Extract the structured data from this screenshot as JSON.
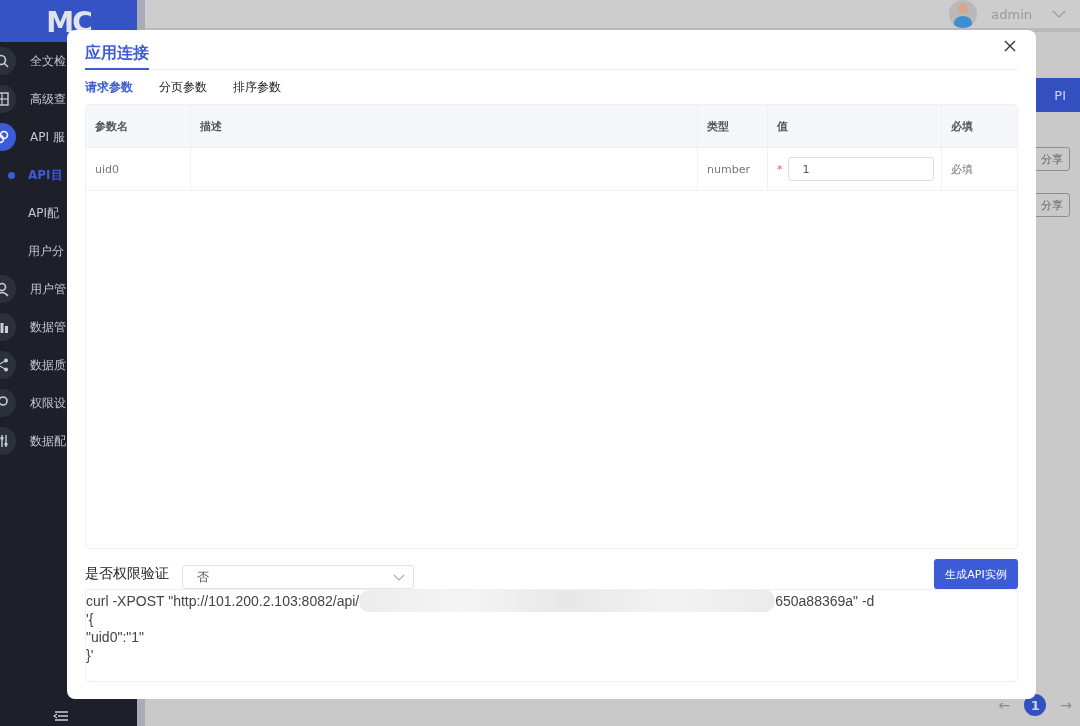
{
  "logo": "MC",
  "sidebar": {
    "items": [
      {
        "label": "全文检",
        "selected": false
      },
      {
        "label": "高级查",
        "selected": false
      },
      {
        "label": "API 服",
        "selected": true,
        "children": [
          {
            "label": "API目",
            "selected": true
          },
          {
            "label": "API配",
            "selected": false
          },
          {
            "label": "用户分",
            "selected": false
          }
        ]
      },
      {
        "label": "用户管",
        "selected": false
      },
      {
        "label": "数据管",
        "selected": false
      },
      {
        "label": "数据质",
        "selected": false
      },
      {
        "label": "权限设",
        "selected": false
      },
      {
        "label": "数据配",
        "selected": false
      }
    ]
  },
  "header": {
    "user": "admin"
  },
  "background": {
    "primary_button": "PI",
    "share_buttons": [
      "分享",
      "分享"
    ],
    "pagination": {
      "page": "1",
      "prev": "←",
      "next": "→"
    }
  },
  "dialog": {
    "title": "应用连接",
    "tabs": [
      {
        "label": "请求参数",
        "selected": true
      },
      {
        "label": "分页参数",
        "selected": false
      },
      {
        "label": "排序参数",
        "selected": false
      }
    ],
    "table": {
      "columns": [
        "参数名",
        "描述",
        "类型",
        "值",
        "必填"
      ],
      "rows": [
        {
          "name": "uid0",
          "type": "number",
          "required_mark": "*",
          "value": "1",
          "required": "必填"
        }
      ]
    },
    "auth": {
      "label": "是否权限验证",
      "value": "否"
    },
    "generate_button": "生成API实例",
    "code": {
      "first_line_start": "curl -XPOST \"http://101.200.2.103:8082/api/",
      "first_line_end": "650a88369a\" -d",
      "lines": [
        "'{",
        "\"uid0\":\"1\"",
        "}'"
      ]
    }
  }
}
